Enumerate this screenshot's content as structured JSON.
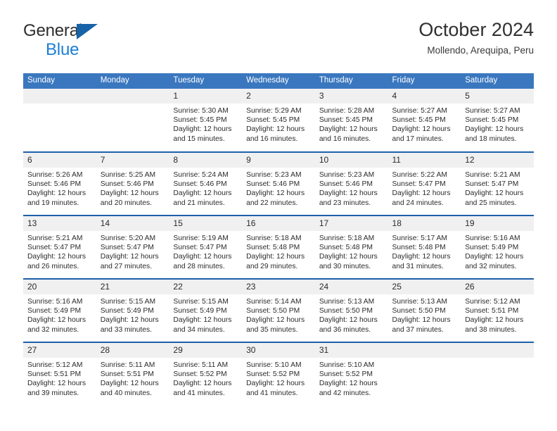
{
  "brand": {
    "line1": "General",
    "line2": "Blue",
    "logo_icon": "triangle-logo-icon",
    "accent_color": "#1763a8"
  },
  "header": {
    "title": "October 2024",
    "subtitle": "Mollendo, Arequipa, Peru"
  },
  "theme": {
    "header_band": "#3a77bf",
    "row_divider": "#1f60a8",
    "daynum_band": "#f0f0f0",
    "text": "#2b2b2b"
  },
  "weekdays": [
    "Sunday",
    "Monday",
    "Tuesday",
    "Wednesday",
    "Thursday",
    "Friday",
    "Saturday"
  ],
  "weeks": [
    [
      {
        "day": "",
        "sunrise": "",
        "sunset": "",
        "daylight1": "",
        "daylight2": ""
      },
      {
        "day": "",
        "sunrise": "",
        "sunset": "",
        "daylight1": "",
        "daylight2": ""
      },
      {
        "day": "1",
        "sunrise": "Sunrise: 5:30 AM",
        "sunset": "Sunset: 5:45 PM",
        "daylight1": "Daylight: 12 hours",
        "daylight2": "and 15 minutes."
      },
      {
        "day": "2",
        "sunrise": "Sunrise: 5:29 AM",
        "sunset": "Sunset: 5:45 PM",
        "daylight1": "Daylight: 12 hours",
        "daylight2": "and 16 minutes."
      },
      {
        "day": "3",
        "sunrise": "Sunrise: 5:28 AM",
        "sunset": "Sunset: 5:45 PM",
        "daylight1": "Daylight: 12 hours",
        "daylight2": "and 16 minutes."
      },
      {
        "day": "4",
        "sunrise": "Sunrise: 5:27 AM",
        "sunset": "Sunset: 5:45 PM",
        "daylight1": "Daylight: 12 hours",
        "daylight2": "and 17 minutes."
      },
      {
        "day": "5",
        "sunrise": "Sunrise: 5:27 AM",
        "sunset": "Sunset: 5:45 PM",
        "daylight1": "Daylight: 12 hours",
        "daylight2": "and 18 minutes."
      }
    ],
    [
      {
        "day": "6",
        "sunrise": "Sunrise: 5:26 AM",
        "sunset": "Sunset: 5:46 PM",
        "daylight1": "Daylight: 12 hours",
        "daylight2": "and 19 minutes."
      },
      {
        "day": "7",
        "sunrise": "Sunrise: 5:25 AM",
        "sunset": "Sunset: 5:46 PM",
        "daylight1": "Daylight: 12 hours",
        "daylight2": "and 20 minutes."
      },
      {
        "day": "8",
        "sunrise": "Sunrise: 5:24 AM",
        "sunset": "Sunset: 5:46 PM",
        "daylight1": "Daylight: 12 hours",
        "daylight2": "and 21 minutes."
      },
      {
        "day": "9",
        "sunrise": "Sunrise: 5:23 AM",
        "sunset": "Sunset: 5:46 PM",
        "daylight1": "Daylight: 12 hours",
        "daylight2": "and 22 minutes."
      },
      {
        "day": "10",
        "sunrise": "Sunrise: 5:23 AM",
        "sunset": "Sunset: 5:46 PM",
        "daylight1": "Daylight: 12 hours",
        "daylight2": "and 23 minutes."
      },
      {
        "day": "11",
        "sunrise": "Sunrise: 5:22 AM",
        "sunset": "Sunset: 5:47 PM",
        "daylight1": "Daylight: 12 hours",
        "daylight2": "and 24 minutes."
      },
      {
        "day": "12",
        "sunrise": "Sunrise: 5:21 AM",
        "sunset": "Sunset: 5:47 PM",
        "daylight1": "Daylight: 12 hours",
        "daylight2": "and 25 minutes."
      }
    ],
    [
      {
        "day": "13",
        "sunrise": "Sunrise: 5:21 AM",
        "sunset": "Sunset: 5:47 PM",
        "daylight1": "Daylight: 12 hours",
        "daylight2": "and 26 minutes."
      },
      {
        "day": "14",
        "sunrise": "Sunrise: 5:20 AM",
        "sunset": "Sunset: 5:47 PM",
        "daylight1": "Daylight: 12 hours",
        "daylight2": "and 27 minutes."
      },
      {
        "day": "15",
        "sunrise": "Sunrise: 5:19 AM",
        "sunset": "Sunset: 5:47 PM",
        "daylight1": "Daylight: 12 hours",
        "daylight2": "and 28 minutes."
      },
      {
        "day": "16",
        "sunrise": "Sunrise: 5:18 AM",
        "sunset": "Sunset: 5:48 PM",
        "daylight1": "Daylight: 12 hours",
        "daylight2": "and 29 minutes."
      },
      {
        "day": "17",
        "sunrise": "Sunrise: 5:18 AM",
        "sunset": "Sunset: 5:48 PM",
        "daylight1": "Daylight: 12 hours",
        "daylight2": "and 30 minutes."
      },
      {
        "day": "18",
        "sunrise": "Sunrise: 5:17 AM",
        "sunset": "Sunset: 5:48 PM",
        "daylight1": "Daylight: 12 hours",
        "daylight2": "and 31 minutes."
      },
      {
        "day": "19",
        "sunrise": "Sunrise: 5:16 AM",
        "sunset": "Sunset: 5:49 PM",
        "daylight1": "Daylight: 12 hours",
        "daylight2": "and 32 minutes."
      }
    ],
    [
      {
        "day": "20",
        "sunrise": "Sunrise: 5:16 AM",
        "sunset": "Sunset: 5:49 PM",
        "daylight1": "Daylight: 12 hours",
        "daylight2": "and 32 minutes."
      },
      {
        "day": "21",
        "sunrise": "Sunrise: 5:15 AM",
        "sunset": "Sunset: 5:49 PM",
        "daylight1": "Daylight: 12 hours",
        "daylight2": "and 33 minutes."
      },
      {
        "day": "22",
        "sunrise": "Sunrise: 5:15 AM",
        "sunset": "Sunset: 5:49 PM",
        "daylight1": "Daylight: 12 hours",
        "daylight2": "and 34 minutes."
      },
      {
        "day": "23",
        "sunrise": "Sunrise: 5:14 AM",
        "sunset": "Sunset: 5:50 PM",
        "daylight1": "Daylight: 12 hours",
        "daylight2": "and 35 minutes."
      },
      {
        "day": "24",
        "sunrise": "Sunrise: 5:13 AM",
        "sunset": "Sunset: 5:50 PM",
        "daylight1": "Daylight: 12 hours",
        "daylight2": "and 36 minutes."
      },
      {
        "day": "25",
        "sunrise": "Sunrise: 5:13 AM",
        "sunset": "Sunset: 5:50 PM",
        "daylight1": "Daylight: 12 hours",
        "daylight2": "and 37 minutes."
      },
      {
        "day": "26",
        "sunrise": "Sunrise: 5:12 AM",
        "sunset": "Sunset: 5:51 PM",
        "daylight1": "Daylight: 12 hours",
        "daylight2": "and 38 minutes."
      }
    ],
    [
      {
        "day": "27",
        "sunrise": "Sunrise: 5:12 AM",
        "sunset": "Sunset: 5:51 PM",
        "daylight1": "Daylight: 12 hours",
        "daylight2": "and 39 minutes."
      },
      {
        "day": "28",
        "sunrise": "Sunrise: 5:11 AM",
        "sunset": "Sunset: 5:51 PM",
        "daylight1": "Daylight: 12 hours",
        "daylight2": "and 40 minutes."
      },
      {
        "day": "29",
        "sunrise": "Sunrise: 5:11 AM",
        "sunset": "Sunset: 5:52 PM",
        "daylight1": "Daylight: 12 hours",
        "daylight2": "and 41 minutes."
      },
      {
        "day": "30",
        "sunrise": "Sunrise: 5:10 AM",
        "sunset": "Sunset: 5:52 PM",
        "daylight1": "Daylight: 12 hours",
        "daylight2": "and 41 minutes."
      },
      {
        "day": "31",
        "sunrise": "Sunrise: 5:10 AM",
        "sunset": "Sunset: 5:52 PM",
        "daylight1": "Daylight: 12 hours",
        "daylight2": "and 42 minutes."
      },
      {
        "day": "",
        "sunrise": "",
        "sunset": "",
        "daylight1": "",
        "daylight2": ""
      },
      {
        "day": "",
        "sunrise": "",
        "sunset": "",
        "daylight1": "",
        "daylight2": ""
      }
    ]
  ]
}
